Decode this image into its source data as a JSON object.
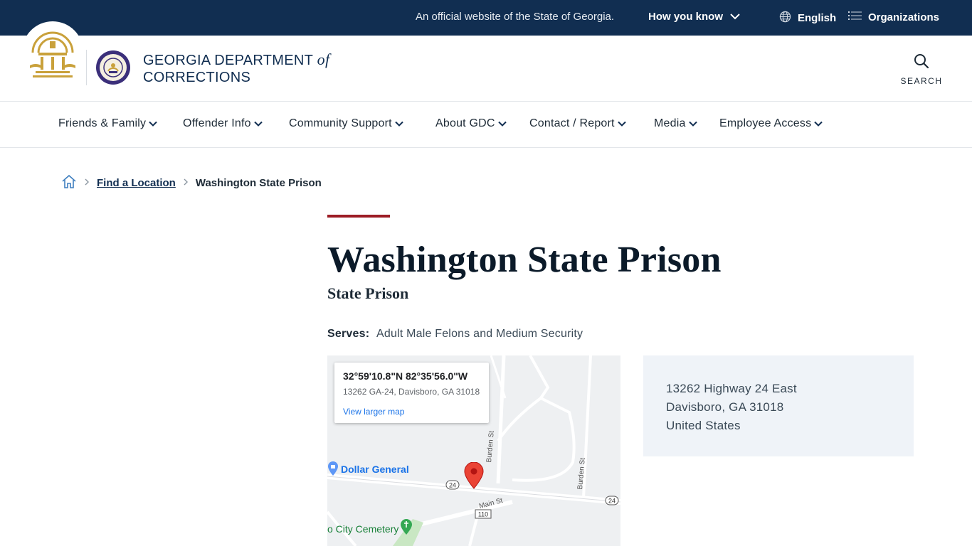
{
  "topbar": {
    "official_text": "An official website of the State of Georgia.",
    "how_you_know": "How you know",
    "language": "English",
    "organizations": "Organizations"
  },
  "header": {
    "agency_line1": "GEORGIA DEPARTMENT",
    "agency_of": "of",
    "agency_line2": "CORRECTIONS",
    "search_label": "SEARCH"
  },
  "nav": {
    "items": [
      {
        "label": "Friends & Family"
      },
      {
        "label": "Offender Info"
      },
      {
        "label": "Community Support"
      },
      {
        "label": "About GDC"
      },
      {
        "label": "Contact / Report"
      },
      {
        "label": "Media"
      },
      {
        "label": "Employee Access"
      }
    ]
  },
  "breadcrumb": {
    "link": "Find a Location",
    "current": "Washington State Prison"
  },
  "page": {
    "title": "Washington State Prison",
    "subtitle": "State Prison",
    "serves_label": "Serves:",
    "serves_value": "Adult Male Felons and Medium Security"
  },
  "map": {
    "coordinates": "32°59'10.8\"N 82°35'56.0\"W",
    "address": "13262 GA-24, Davisboro, GA 31018",
    "view_larger": "View larger map",
    "poi_dollar_general": "Dollar General",
    "poi_cemetery": "o City Cemetery",
    "road_burden_st": "Burden St",
    "road_main_st": "Main St",
    "shield_24": "24",
    "shield_110": "110",
    "colors": {
      "pin": "#ea4335",
      "poi_blue": "#1a73e8",
      "poi_green": "#34a853"
    }
  },
  "address": {
    "line1": "13262 Highway 24 East",
    "line2": "Davisboro, GA 31018",
    "line3": "United States"
  },
  "colors": {
    "navy": "#112e51",
    "accent_red": "#9c1c25",
    "seal_gold": "#c9a13b"
  }
}
